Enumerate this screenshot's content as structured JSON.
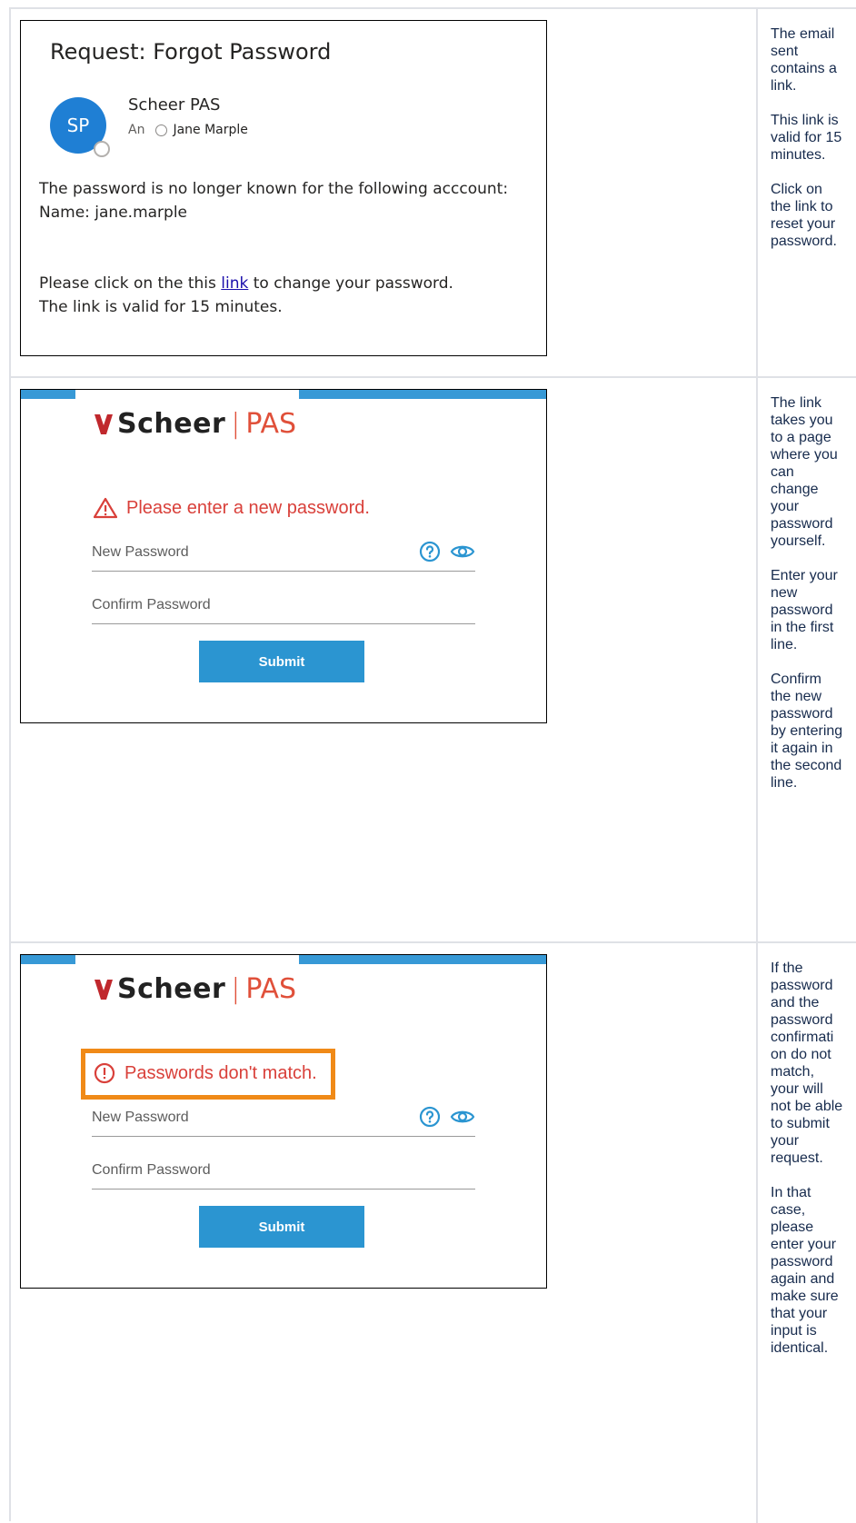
{
  "email": {
    "subject": "Request: Forgot Password",
    "avatar_initials": "SP",
    "sender_name": "Scheer PAS",
    "recipient_prefix": "An",
    "recipient_name": "Jane Marple",
    "body_line1": "The password is no longer known for the following acccount:",
    "body_line2": "Name: jane.marple",
    "body_line3_before": "Please click on the this ",
    "body_link": "link",
    "body_line3_after": " to change your password.",
    "body_line4": "The link is valid for 15 minutes."
  },
  "row1_notes": [
    "The email sent contains a link.",
    "This link is valid for 15 minutes.",
    "Click on the link to reset your password."
  ],
  "form1": {
    "logo_scheer": "Scheer",
    "logo_sep": "|",
    "logo_pas": "PAS",
    "message": "Please enter a new password.",
    "new_password_placeholder": "New Password",
    "confirm_password_placeholder": "Confirm Password",
    "submit_label": "Submit"
  },
  "row2_notes": [
    "The link takes you to a page where you can change your password yourself.",
    "Enter your new password in the first line.",
    "Confirm the new password by entering it again in the second line."
  ],
  "form2": {
    "logo_scheer": "Scheer",
    "logo_sep": "|",
    "logo_pas": "PAS",
    "message": "Passwords don't match.",
    "new_password_placeholder": "New Password",
    "confirm_password_placeholder": "Confirm Password",
    "submit_label": "Submit"
  },
  "row3_notes": [
    "If the password and the password confirmati on do not match, your will not be able to submit your request.",
    "In that case, please enter your password again and make sure that your input is identical."
  ],
  "colors": {
    "accent": "#2b95d1",
    "error": "#d9403a",
    "highlight": "#f08a17",
    "brand_red": "#e0503a"
  }
}
